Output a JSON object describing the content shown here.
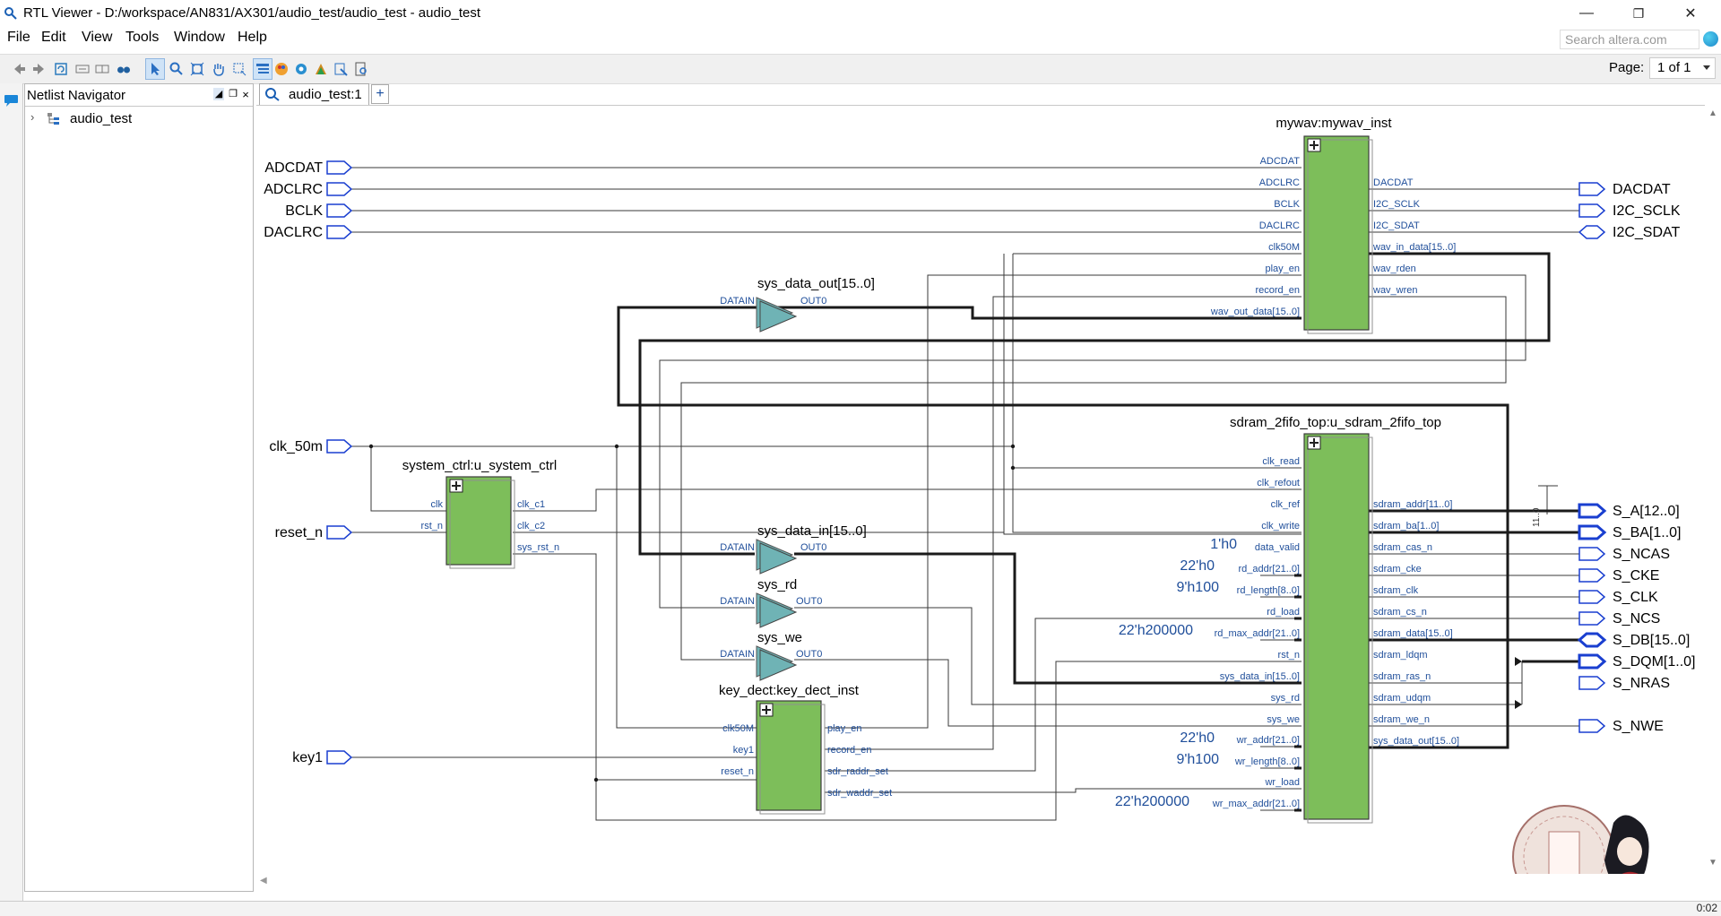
{
  "window": {
    "title": "RTL Viewer - D:/workspace/AN831/AX301/audio_test/audio_test - audio_test"
  },
  "menu": [
    "File",
    "Edit",
    "View",
    "Tools",
    "Window",
    "Help"
  ],
  "search": {
    "placeholder": "Search altera.com"
  },
  "page": {
    "label": "Page:",
    "value": "1 of 1"
  },
  "navigator": {
    "title": "Netlist Navigator",
    "tree": [
      {
        "label": "audio_test",
        "expanded": false
      }
    ]
  },
  "tab": {
    "label": "audio_test:1"
  },
  "status": {
    "clock_fragment": "0:02"
  },
  "schematic": {
    "blocks": {
      "mywav": {
        "title": "mywav:mywav_inst",
        "inputs": [
          "ADCDAT",
          "ADCLRC",
          "BCLK",
          "DACLRC",
          "clk50M",
          "play_en",
          "record_en",
          "wav_out_data[15..0]"
        ],
        "outputs": [
          "DACDAT",
          "I2C_SCLK",
          "I2C_SDAT",
          "wav_in_data[15..0]",
          "wav_rden",
          "wav_wren"
        ]
      },
      "sdram": {
        "title": "sdram_2fifo_top:u_sdram_2fifo_top",
        "inputs": [
          "clk_read",
          "clk_refout",
          "clk_ref",
          "clk_write",
          "data_valid",
          "rd_addr[21..0]",
          "rd_length[8..0]",
          "rd_load",
          "rd_max_addr[21..0]",
          "rst_n",
          "sys_data_in[15..0]",
          "sys_rd",
          "sys_we",
          "wr_addr[21..0]",
          "wr_length[8..0]",
          "wr_load",
          "wr_max_addr[21..0]"
        ],
        "outputs": [
          "sdram_addr[11..0]",
          "sdram_ba[1..0]",
          "sdram_cas_n",
          "sdram_cke",
          "sdram_clk",
          "sdram_cs_n",
          "sdram_data[15..0]",
          "sdram_ldqm",
          "sdram_ras_n",
          "sdram_udqm",
          "sdram_we_n",
          "sys_data_out[15..0]"
        ]
      },
      "sysctrl": {
        "title": "system_ctrl:u_system_ctrl",
        "inputs": [
          "clk",
          "rst_n"
        ],
        "outputs": [
          "clk_c1",
          "clk_c2",
          "sys_rst_n"
        ]
      },
      "keydect": {
        "title": "key_dect:key_dect_inst",
        "inputs": [
          "clk50M",
          "key1",
          "reset_n"
        ],
        "outputs": [
          "play_en",
          "record_en",
          "sdr_raddr_set",
          "sdr_waddr_set"
        ]
      }
    },
    "buffers": [
      {
        "name": "sys_data_out[15..0]",
        "in": "DATAIN",
        "out": "OUT0"
      },
      {
        "name": "sys_data_in[15..0]",
        "in": "DATAIN",
        "out": "OUT0"
      },
      {
        "name": "sys_rd",
        "in": "DATAIN",
        "out": "OUT0"
      },
      {
        "name": "sys_we",
        "in": "DATAIN",
        "out": "OUT0"
      }
    ],
    "input_ports": [
      "ADCDAT",
      "ADCLRC",
      "BCLK",
      "DACLRC",
      "clk_50m",
      "reset_n",
      "key1"
    ],
    "output_ports": [
      "DACDAT",
      "I2C_SCLK",
      "I2C_SDAT",
      "S_A[12..0]",
      "S_BA[1..0]",
      "S_NCAS",
      "S_CKE",
      "S_CLK",
      "S_NCS",
      "S_DB[15..0]",
      "S_DQM[1..0]",
      "S_NRAS",
      "S_NWE"
    ],
    "constants": [
      "1'h0",
      "22'h0",
      "9'h100",
      "22'h200000",
      "22'h0",
      "9'h100",
      "22'h200000"
    ],
    "bus_tap": "11..0",
    "colors": {
      "block": "#7dbe5a",
      "buffer": "#6fb3b5",
      "port": "#1a3fd0",
      "pin_label": "#1f4e9a"
    }
  }
}
